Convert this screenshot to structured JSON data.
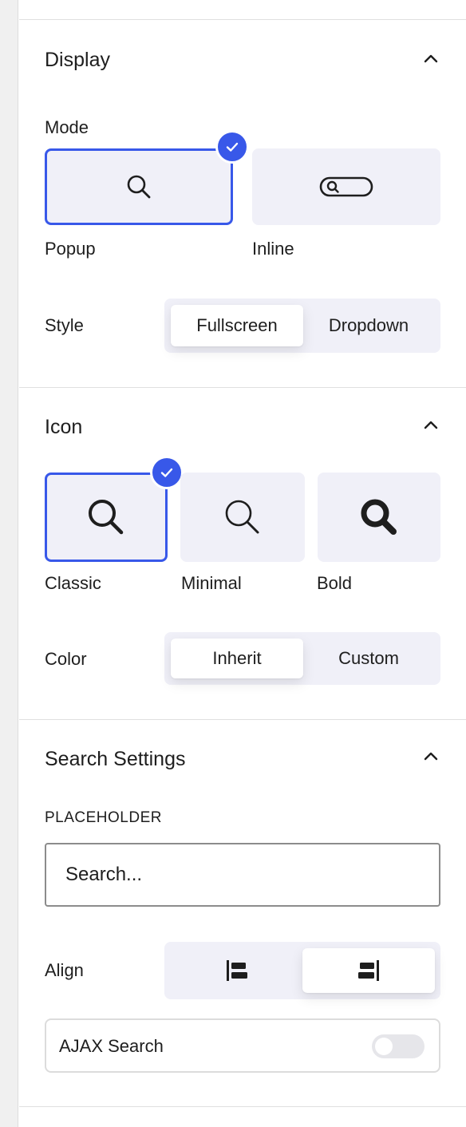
{
  "display": {
    "title": "Display",
    "mode_label": "Mode",
    "modes": [
      {
        "label": "Popup",
        "icon": "search-icon",
        "selected": true
      },
      {
        "label": "Inline",
        "icon": "search-bar-icon",
        "selected": false
      }
    ],
    "style_label": "Style",
    "style_options": [
      "Fullscreen",
      "Dropdown"
    ],
    "style_selected": "Fullscreen"
  },
  "icon": {
    "title": "Icon",
    "options": [
      {
        "label": "Classic",
        "icon": "search-classic-icon",
        "selected": true
      },
      {
        "label": "Minimal",
        "icon": "search-minimal-icon",
        "selected": false
      },
      {
        "label": "Bold",
        "icon": "search-bold-icon",
        "selected": false
      }
    ],
    "color_label": "Color",
    "color_options": [
      "Inherit",
      "Custom"
    ],
    "color_selected": "Inherit"
  },
  "search_settings": {
    "title": "Search Settings",
    "placeholder_label": "PLACEHOLDER",
    "placeholder_value": "Search...",
    "align_label": "Align",
    "align_options": [
      "align-left-icon",
      "align-right-icon"
    ],
    "align_selected": "align-right-icon",
    "ajax_label": "AJAX Search",
    "ajax_enabled": false
  },
  "colors": {
    "accent": "#3858e9",
    "tile_bg": "#f0f0f8",
    "text": "#1e1e1e"
  }
}
